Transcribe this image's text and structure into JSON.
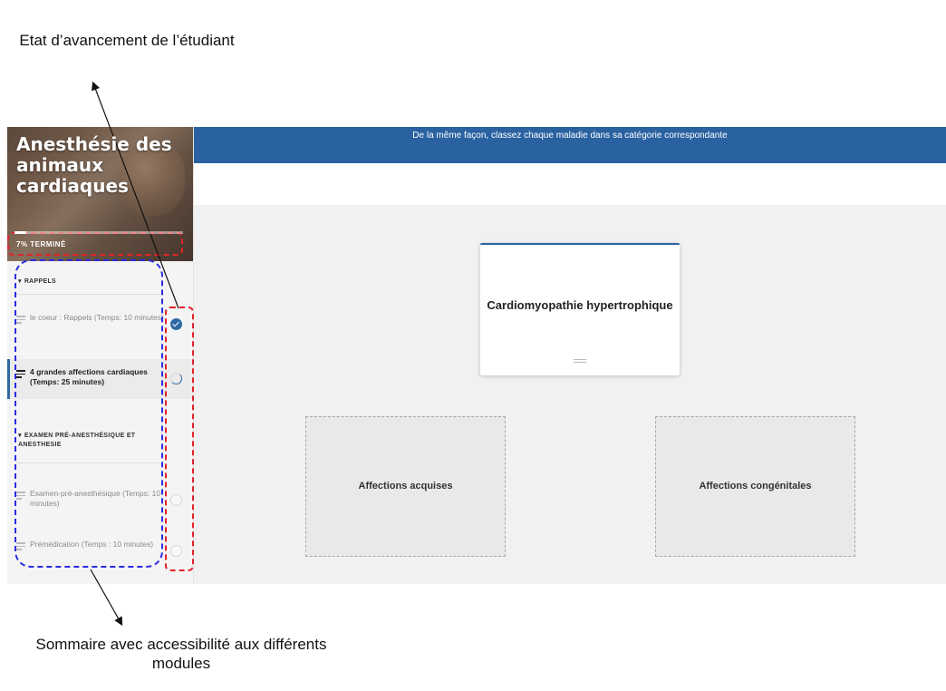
{
  "annotations": {
    "top": "Etat d’avancement de l’étudiant",
    "bottom": "Sommaire avec accessibilité aux différents modules"
  },
  "course": {
    "title": "Anesthésie des animaux cardiaques",
    "progress_label": "7% TERMINÉ",
    "progress_fraction": 0.07
  },
  "sidebar": {
    "sections": [
      {
        "title": "RAPPELS"
      },
      {
        "title": "EXAMEN PRÉ-ANESTHÉSIQUE ET ANESTHESIE"
      }
    ],
    "lessons": [
      {
        "label": "le coeur : Rappels (Temps: 10 minutes)",
        "status": "complete"
      },
      {
        "label": "4 grandes affections cardiaques (Temps: 25 minutes)",
        "status": "in-progress"
      },
      {
        "label": "Examen-pré-anesthésique (Temps: 10 minutes)",
        "status": "not-started"
      },
      {
        "label": "Prémédication (Temps : 10 minutes)",
        "status": "not-started"
      }
    ]
  },
  "main": {
    "instruction": "De la même façon,  classez chaque maladie dans sa catégorie correspondante",
    "card_label": "Cardiomyopathie hypertrophique",
    "drop_zones": [
      "Affections acquises",
      "Affections congénitales"
    ]
  },
  "colors": {
    "primary_blue": "#2a62a1",
    "annotation_red": "#e2232a",
    "annotation_blue": "#2b2be0"
  }
}
